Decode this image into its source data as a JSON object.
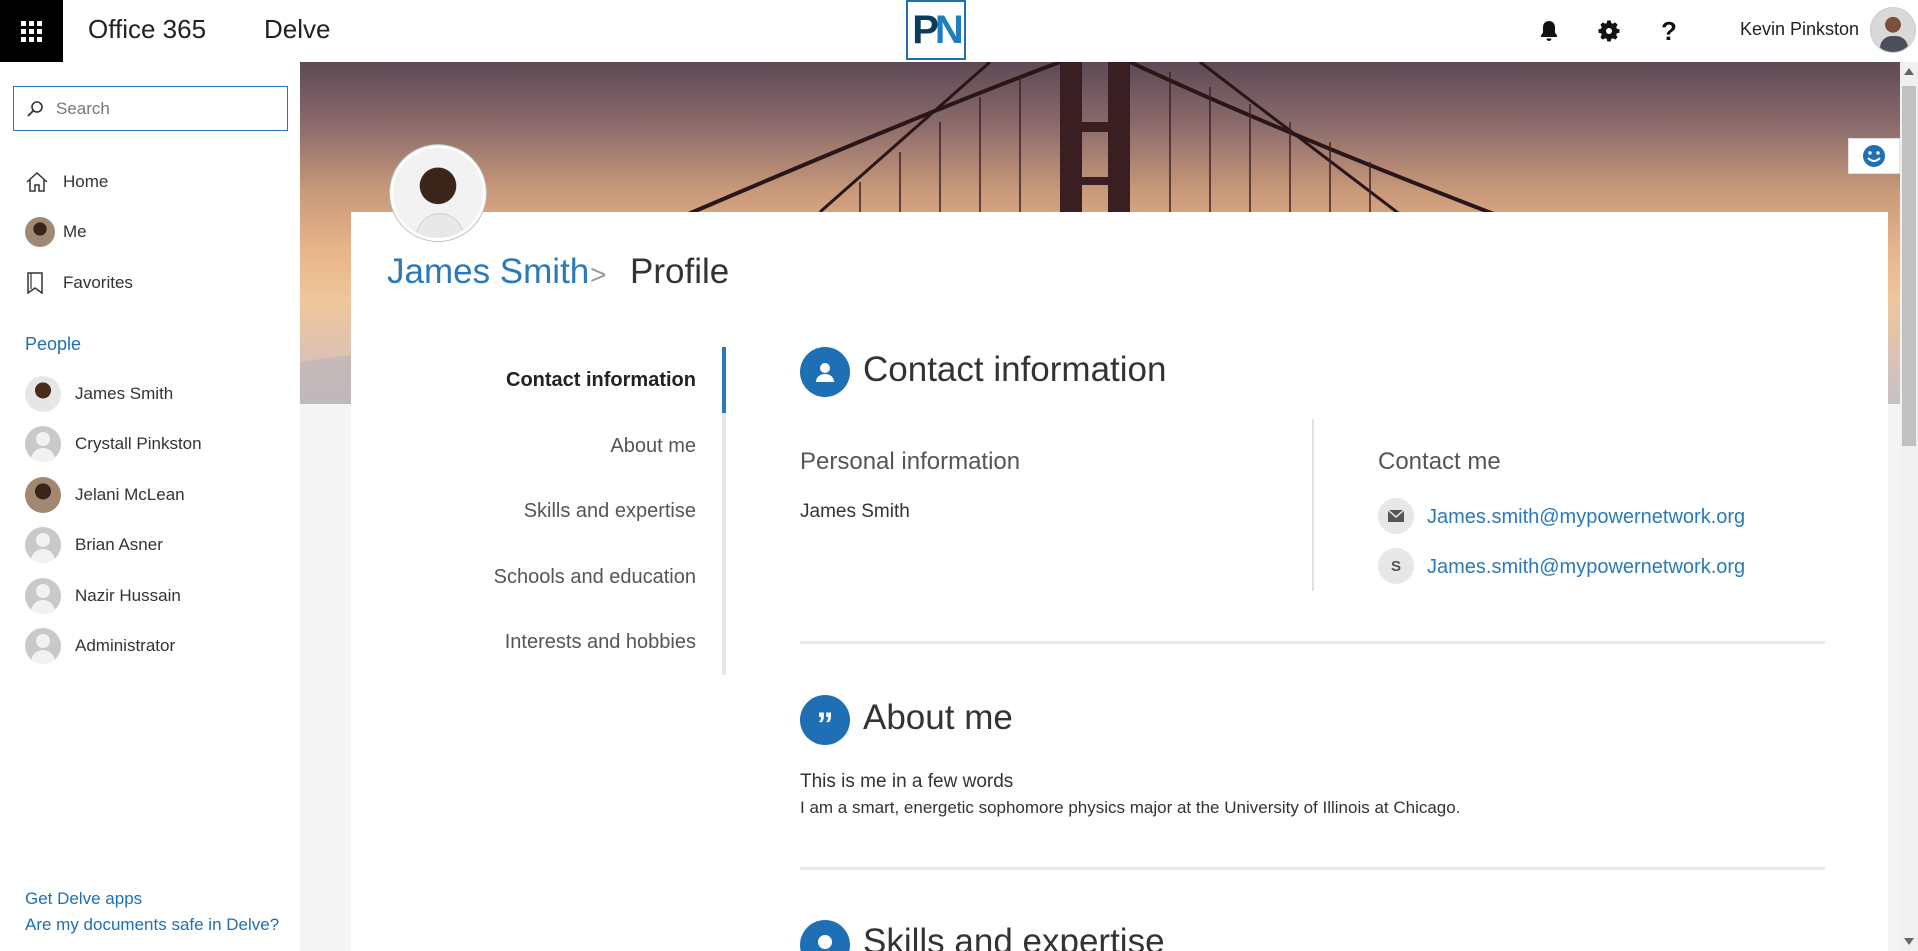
{
  "topbar": {
    "brand": "Office 365",
    "app_name": "Delve",
    "logo_p": "P",
    "logo_n": "N",
    "user_name": "Kevin Pinkston",
    "icons": [
      "app-launcher-icon",
      "notification-bell-icon",
      "settings-gear-icon",
      "help-question-icon"
    ]
  },
  "leftnav": {
    "search_placeholder": "Search",
    "items": [
      {
        "label": "Home",
        "icon": "home-icon"
      },
      {
        "label": "Me",
        "icon": "avatar"
      },
      {
        "label": "Favorites",
        "icon": "bookmark-icon"
      }
    ],
    "people_heading": "People",
    "people": [
      {
        "name": "James Smith"
      },
      {
        "name": "Crystall Pinkston"
      },
      {
        "name": "Jelani McLean"
      },
      {
        "name": "Brian Asner"
      },
      {
        "name": "Nazir Hussain"
      },
      {
        "name": "Administrator"
      }
    ],
    "footer_links": [
      "Get Delve apps",
      "Are my documents safe in Delve?"
    ]
  },
  "profile": {
    "breadcrumb_name": "James Smith",
    "breadcrumb_separator": ">",
    "breadcrumb_page": "Profile",
    "tabs": [
      {
        "label": "Contact information",
        "active": true
      },
      {
        "label": "About me"
      },
      {
        "label": "Skills and expertise"
      },
      {
        "label": "Schools and education"
      },
      {
        "label": "Interests and hobbies"
      }
    ]
  },
  "contact": {
    "title": "Contact information",
    "personal_heading": "Personal information",
    "personal_name": "James Smith",
    "contact_heading": "Contact me",
    "email": "James.smith@mypowernetwork.org",
    "skype": "James.smith@mypowernetwork.org"
  },
  "about": {
    "title": "About me",
    "tagline": "This is me in a few words",
    "text": "I am a smart, energetic sophomore physics major at the University of Illinois at Chicago."
  },
  "skills": {
    "title": "Skills and expertise"
  },
  "colors": {
    "accent": "#2b79b8",
    "icon_circle": "#1e6fb4",
    "waffle_bg": "#000000"
  }
}
